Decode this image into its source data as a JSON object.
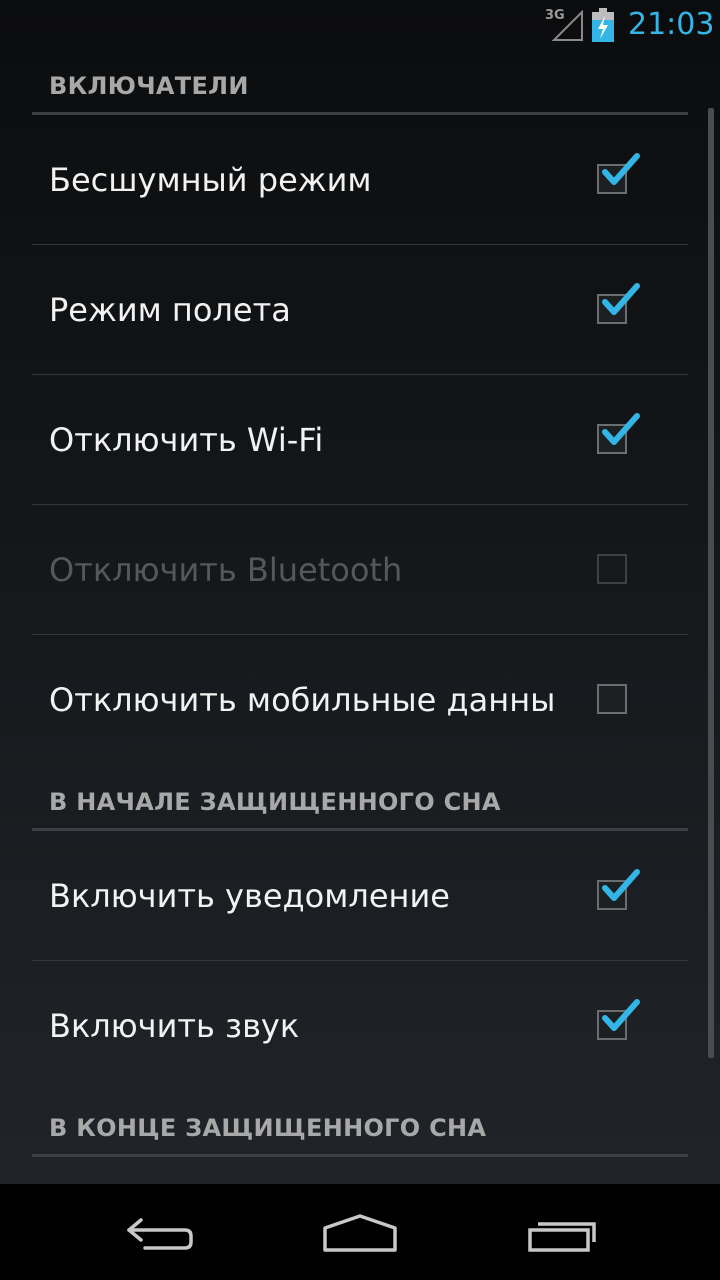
{
  "status_bar": {
    "network_type": "3G",
    "time": "21:03",
    "icons": [
      "signal-icon",
      "battery-charging-icon"
    ]
  },
  "colors": {
    "accent": "#33b5e5",
    "header_text": "#a8a8a8",
    "item_text": "#f2f2f2",
    "disabled_text": "#555759"
  },
  "sections": [
    {
      "title": "ВКЛЮЧАТЕЛИ",
      "items": [
        {
          "label": "Бесшумный режим",
          "checked": true,
          "enabled": true
        },
        {
          "label": "Режим полета",
          "checked": true,
          "enabled": true
        },
        {
          "label": "Отключить Wi-Fi",
          "checked": true,
          "enabled": true
        },
        {
          "label": "Отключить Bluetooth",
          "checked": false,
          "enabled": false
        },
        {
          "label": "Отключить мобильные данные",
          "checked": false,
          "enabled": true
        }
      ]
    },
    {
      "title": "В НАЧАЛЕ ЗАЩИЩЕННОГО СНА",
      "items": [
        {
          "label": "Включить уведомление",
          "checked": true,
          "enabled": true
        },
        {
          "label": "Включить звук",
          "checked": true,
          "enabled": true
        }
      ]
    },
    {
      "title": "В КОНЦЕ ЗАЩИЩЕННОГО СНА",
      "items": []
    }
  ],
  "nav_bar": {
    "buttons": [
      "back-icon",
      "home-icon",
      "recent-apps-icon"
    ]
  }
}
